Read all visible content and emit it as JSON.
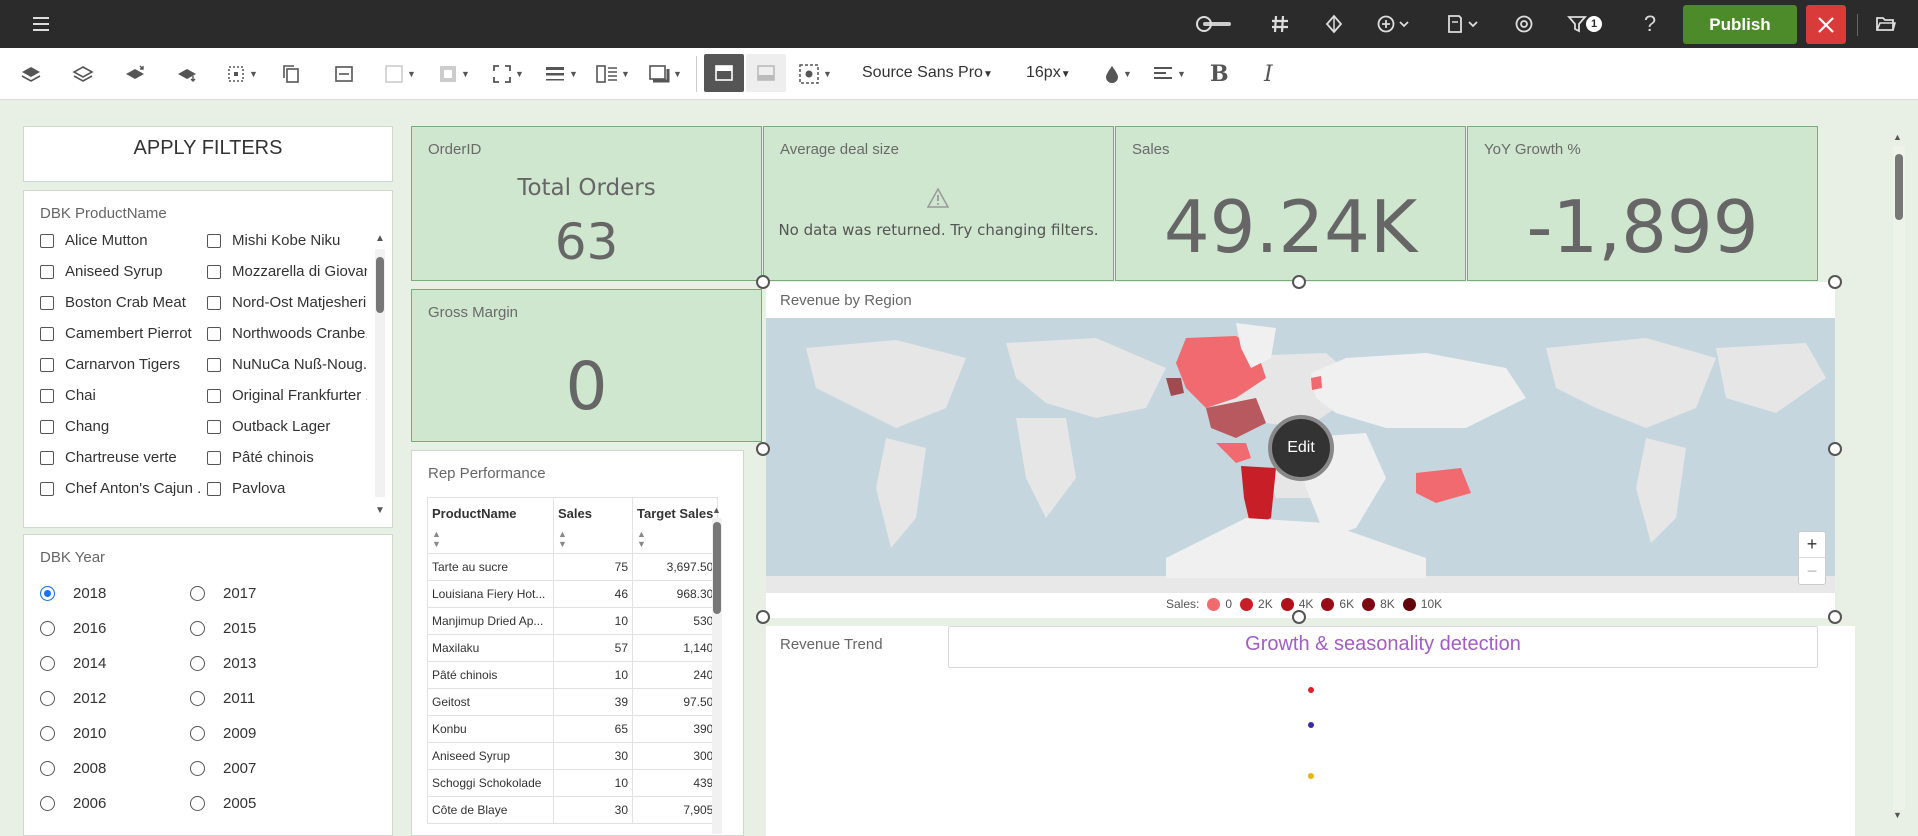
{
  "topbar": {
    "menu_icon": "hamburger-icon",
    "publish_label": "Publish",
    "filter_count": "1"
  },
  "toolbar": {
    "font_family": "Source Sans Pro",
    "font_size": "16px",
    "bold_label": "B",
    "italic_label": "I"
  },
  "filters": {
    "apply_label": "APPLY FILTERS",
    "product": {
      "title": "DBK ProductName",
      "col1": [
        "Alice Mutton",
        "Aniseed Syrup",
        "Boston Crab Meat",
        "Camembert Pierrot",
        "Carnarvon Tigers",
        "Chai",
        "Chang",
        "Chartreuse verte",
        "Chef Anton's Cajun ..."
      ],
      "col2": [
        "Mishi Kobe Niku",
        "Mozzarella di Giovan",
        "Nord-Ost Matjesheri.",
        "Northwoods Cranbe.",
        "NuNuCa Nuß-Noug..",
        "Original Frankfurter .",
        "Outback Lager",
        "Pâté chinois",
        "Pavlova"
      ]
    },
    "year": {
      "title": "DBK Year",
      "col1": [
        "2018",
        "2016",
        "2014",
        "2012",
        "2010",
        "2008",
        "2006"
      ],
      "col2": [
        "2017",
        "2015",
        "2013",
        "2011",
        "2009",
        "2007",
        "2005"
      ],
      "selected": "2018"
    }
  },
  "kpis": {
    "orders": {
      "title": "OrderID",
      "label": "Total Orders",
      "value": "63"
    },
    "deal": {
      "title": "Average deal size",
      "message": "No data was returned. Try changing filters."
    },
    "sales": {
      "title": "Sales",
      "value": "49.24K"
    },
    "yoy": {
      "title": "YoY Growth %",
      "value": "-1,899"
    },
    "margin": {
      "title": "Gross Margin",
      "value": "0"
    }
  },
  "rep": {
    "title": "Rep Performance",
    "headers": [
      "ProductName",
      "Sales",
      "Target Sales"
    ],
    "rows": [
      [
        "Tarte au sucre",
        "75",
        "3,697.50"
      ],
      [
        "Louisiana Fiery Hot...",
        "46",
        "968.30"
      ],
      [
        "Manjimup Dried Ap...",
        "10",
        "530"
      ],
      [
        "Maxilaku",
        "57",
        "1,140"
      ],
      [
        "Pâté chinois",
        "10",
        "240"
      ],
      [
        "Geitost",
        "39",
        "97.50"
      ],
      [
        "Konbu",
        "65",
        "390"
      ],
      [
        "Aniseed Syrup",
        "30",
        "300"
      ],
      [
        "Schoggi Schokolade",
        "10",
        "439"
      ],
      [
        "Côte de Blaye",
        "30",
        "7,905"
      ]
    ]
  },
  "region": {
    "title": "Revenue by Region",
    "edit_label": "Edit",
    "zoom_in": "+",
    "zoom_out": "−",
    "legend_label": "Sales:",
    "legend": [
      {
        "label": "0",
        "color": "#f06a70"
      },
      {
        "label": "2K",
        "color": "#c81e28"
      },
      {
        "label": "4K",
        "color": "#b0101c"
      },
      {
        "label": "6K",
        "color": "#980c18"
      },
      {
        "label": "8K",
        "color": "#7e0812"
      },
      {
        "label": "10K",
        "color": "#62040c"
      }
    ]
  },
  "trend": {
    "title": "Revenue Trend",
    "banner": "Growth & seasonality detection",
    "dot_colors": [
      "#e0202a",
      "#3a2aa8",
      "#e8b400"
    ]
  }
}
